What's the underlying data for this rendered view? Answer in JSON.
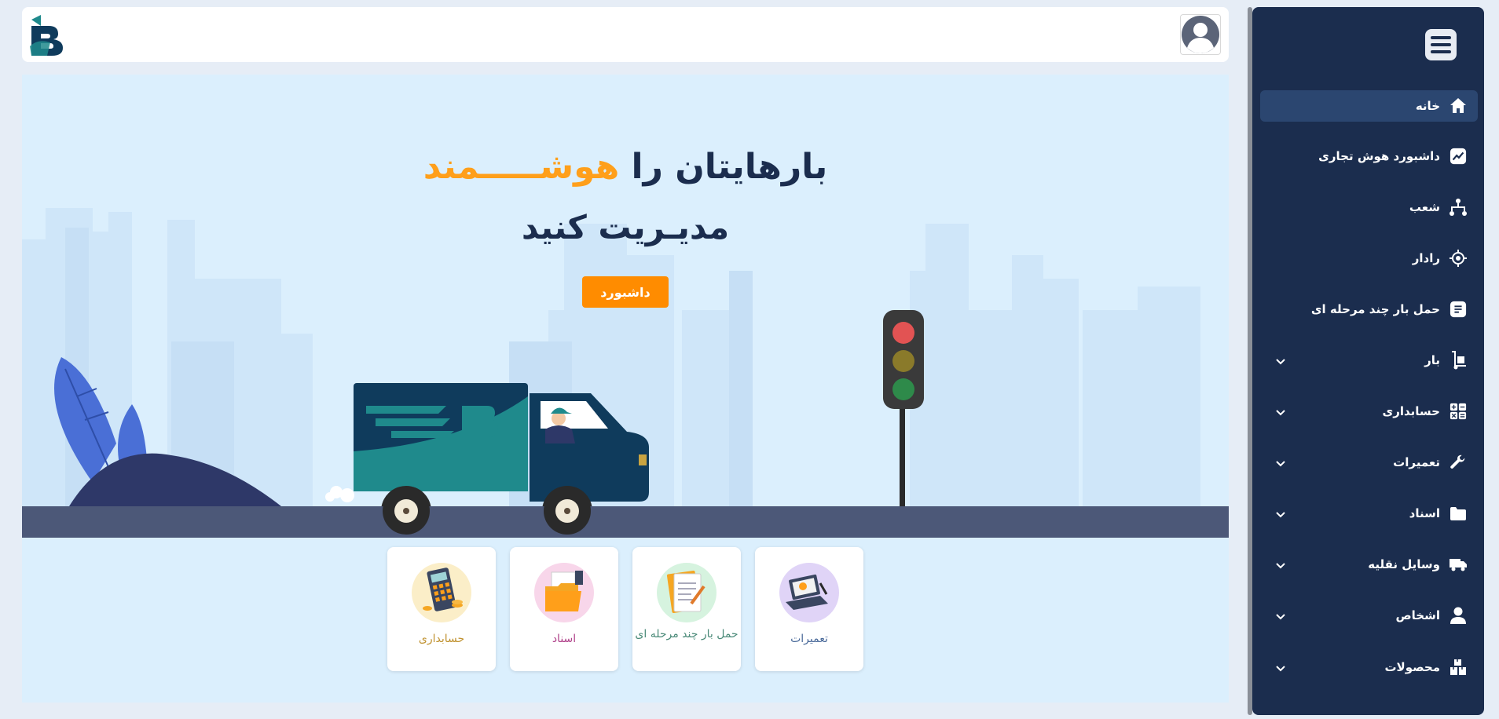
{
  "sidebar": {
    "items": [
      {
        "label": "خانه",
        "icon": "home-icon",
        "active": true,
        "has_submenu": false
      },
      {
        "label": "داشبورد هوش تجاری",
        "icon": "chart-icon",
        "active": false,
        "has_submenu": false
      },
      {
        "label": "شعب",
        "icon": "branches-icon",
        "active": false,
        "has_submenu": false
      },
      {
        "label": "رادار",
        "icon": "radar-icon",
        "active": false,
        "has_submenu": false
      },
      {
        "label": "حمل بار چند مرحله ای",
        "icon": "document-icon",
        "active": false,
        "has_submenu": false
      },
      {
        "label": "بار",
        "icon": "cargo-dolly-icon",
        "active": false,
        "has_submenu": true
      },
      {
        "label": "حسابداری",
        "icon": "calculator-icon",
        "active": false,
        "has_submenu": true
      },
      {
        "label": "تعمیرات",
        "icon": "wrench-icon",
        "active": false,
        "has_submenu": true
      },
      {
        "label": "اسناد",
        "icon": "folder-icon",
        "active": false,
        "has_submenu": true
      },
      {
        "label": "وسایل نقلیه",
        "icon": "truck-icon",
        "active": false,
        "has_submenu": true
      },
      {
        "label": "اشخاص",
        "icon": "person-icon",
        "active": false,
        "has_submenu": true
      },
      {
        "label": "محصولات",
        "icon": "boxes-icon",
        "active": false,
        "has_submenu": true
      }
    ]
  },
  "hero": {
    "line1_prefix": "بارهایتان را ",
    "line1_accent": "هوشـــــمند",
    "line2": "مدیـریت کنید",
    "button_label": "داشبورد"
  },
  "cards": [
    {
      "label": "تعمیرات",
      "color": "#4a6a9a",
      "circle": "#e0d4f7"
    },
    {
      "label": "حمل بار چند مرحله ای",
      "color": "#4a8a78",
      "circle": "#d6f3df"
    },
    {
      "label": "اسناد",
      "color": "#b0418a",
      "circle": "#f8d6ea"
    },
    {
      "label": "حسابداری",
      "color": "#c09230",
      "circle": "#fbeec8"
    }
  ],
  "colors": {
    "sidebar_bg": "#1b2d4e",
    "accent": "#ff8c00",
    "headline": "#1b2d4e",
    "road": "#4c5878"
  }
}
